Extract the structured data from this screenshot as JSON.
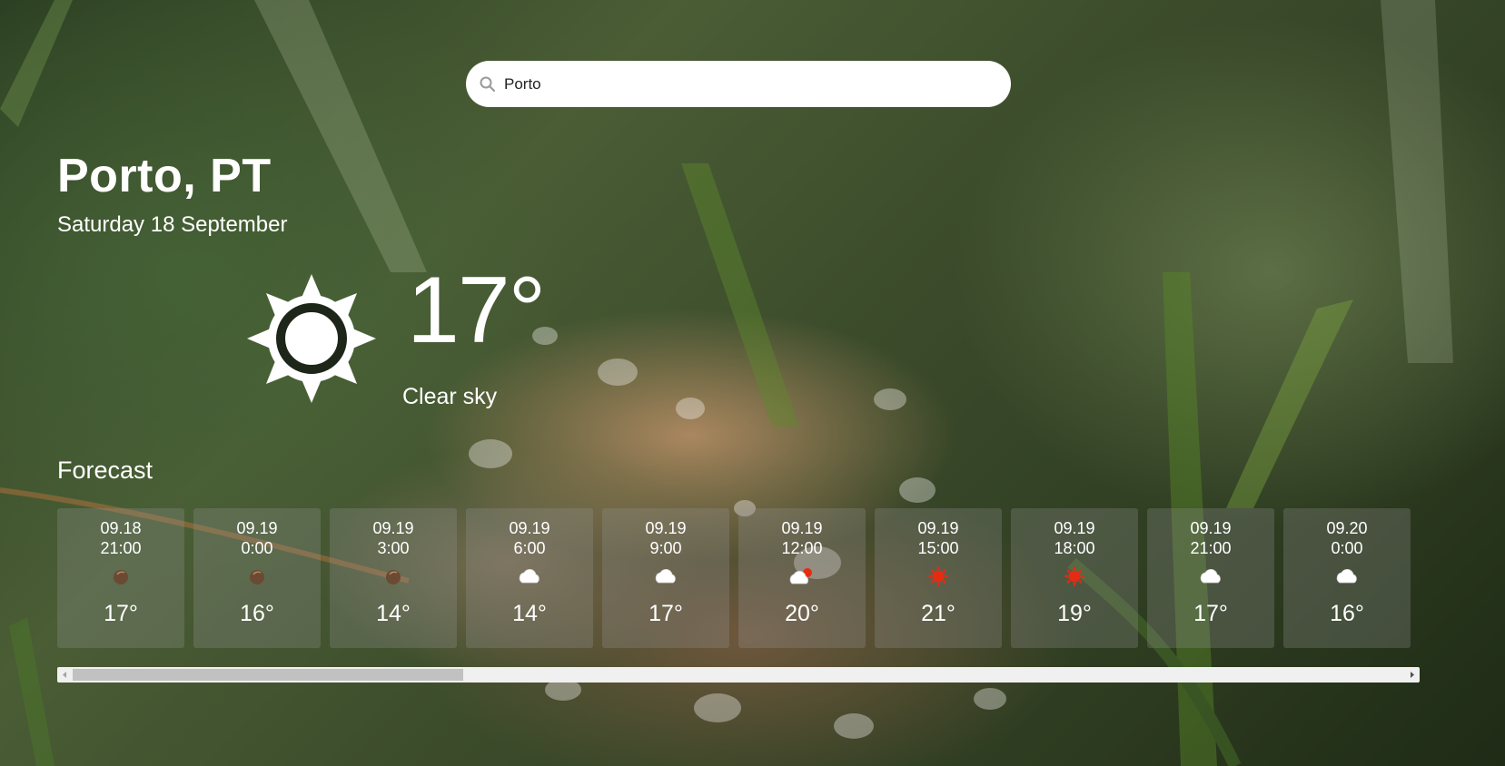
{
  "search": {
    "value": "Porto",
    "placeholder": ""
  },
  "location": {
    "city": "Porto, PT",
    "date": "Saturday 18 September"
  },
  "current": {
    "temp": "17°",
    "condition": "Clear sky",
    "icon": "sun-icon"
  },
  "forecast": {
    "title": "Forecast",
    "items": [
      {
        "date": "09.18",
        "time": "21:00",
        "icon": "moon-icon",
        "temp": "17°"
      },
      {
        "date": "09.19",
        "time": "0:00",
        "icon": "moon-icon",
        "temp": "16°"
      },
      {
        "date": "09.19",
        "time": "3:00",
        "icon": "moon-icon",
        "temp": "14°"
      },
      {
        "date": "09.19",
        "time": "6:00",
        "icon": "cloud-icon",
        "temp": "14°"
      },
      {
        "date": "09.19",
        "time": "9:00",
        "icon": "cloud-icon",
        "temp": "17°"
      },
      {
        "date": "09.19",
        "time": "12:00",
        "icon": "cloud-sun-icon",
        "temp": "20°"
      },
      {
        "date": "09.19",
        "time": "15:00",
        "icon": "sun-icon",
        "temp": "21°"
      },
      {
        "date": "09.19",
        "time": "18:00",
        "icon": "sun-icon",
        "temp": "19°"
      },
      {
        "date": "09.19",
        "time": "21:00",
        "icon": "cloud-icon",
        "temp": "17°"
      },
      {
        "date": "09.20",
        "time": "0:00",
        "icon": "cloud-icon",
        "temp": "16°"
      }
    ]
  },
  "colors": {
    "sun": "#e52b12",
    "moon": "#6b4a33",
    "cloud": "#ffffff"
  }
}
